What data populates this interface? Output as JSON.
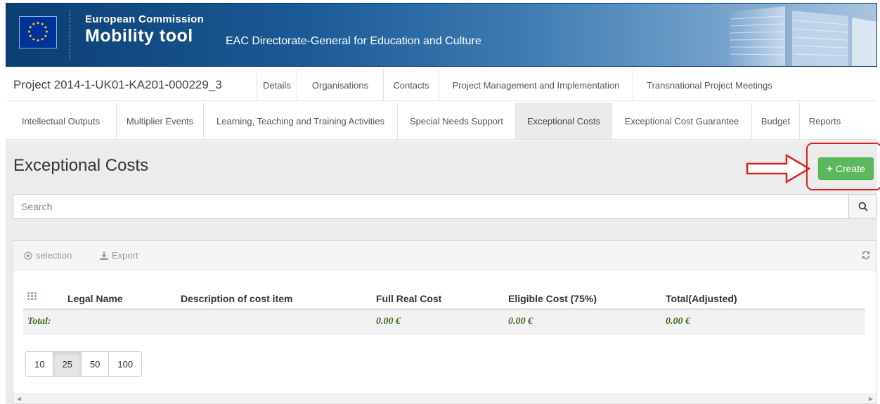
{
  "header": {
    "brand_top": "European Commission",
    "brand_main": "Mobility tool",
    "brand_sub": "EAC Directorate-General for Education and Culture"
  },
  "project": {
    "title": "Project 2014-1-UK01-KA201-000229_3"
  },
  "tabs_row1": [
    {
      "label": "Details"
    },
    {
      "label": "Organisations"
    },
    {
      "label": "Contacts"
    },
    {
      "label": "Project Management and Implementation"
    },
    {
      "label": "Transnational Project Meetings"
    }
  ],
  "tabs_row2": [
    {
      "label": "Intellectual Outputs"
    },
    {
      "label": "Multiplier Events"
    },
    {
      "label": "Learning, Teaching and Training Activities"
    },
    {
      "label": "Special Needs Support"
    },
    {
      "label": "Exceptional Costs",
      "active": true
    },
    {
      "label": "Exceptional Cost Guarantee"
    },
    {
      "label": "Budget"
    },
    {
      "label": "Reports"
    }
  ],
  "page": {
    "title": "Exceptional Costs",
    "create_label": "Create"
  },
  "search": {
    "placeholder": "Search"
  },
  "toolbar": {
    "selection_label": "selection",
    "export_label": "Export"
  },
  "table": {
    "columns": [
      "Legal Name",
      "Description of cost item",
      "Full Real Cost",
      "Eligible Cost (75%)",
      "Total(Adjusted)"
    ],
    "total": {
      "label": "Total:",
      "full_real_cost": "0.00 €",
      "eligible_cost": "0.00 €",
      "total_adjusted": "0.00 €"
    }
  },
  "pager": {
    "sizes": [
      "10",
      "25",
      "50",
      "100"
    ],
    "active": "25"
  },
  "colors": {
    "accent_green": "#5cb85c",
    "highlight_red": "#e02020",
    "banner_blue": "#0b3e73",
    "total_text": "#3c6b1f"
  }
}
